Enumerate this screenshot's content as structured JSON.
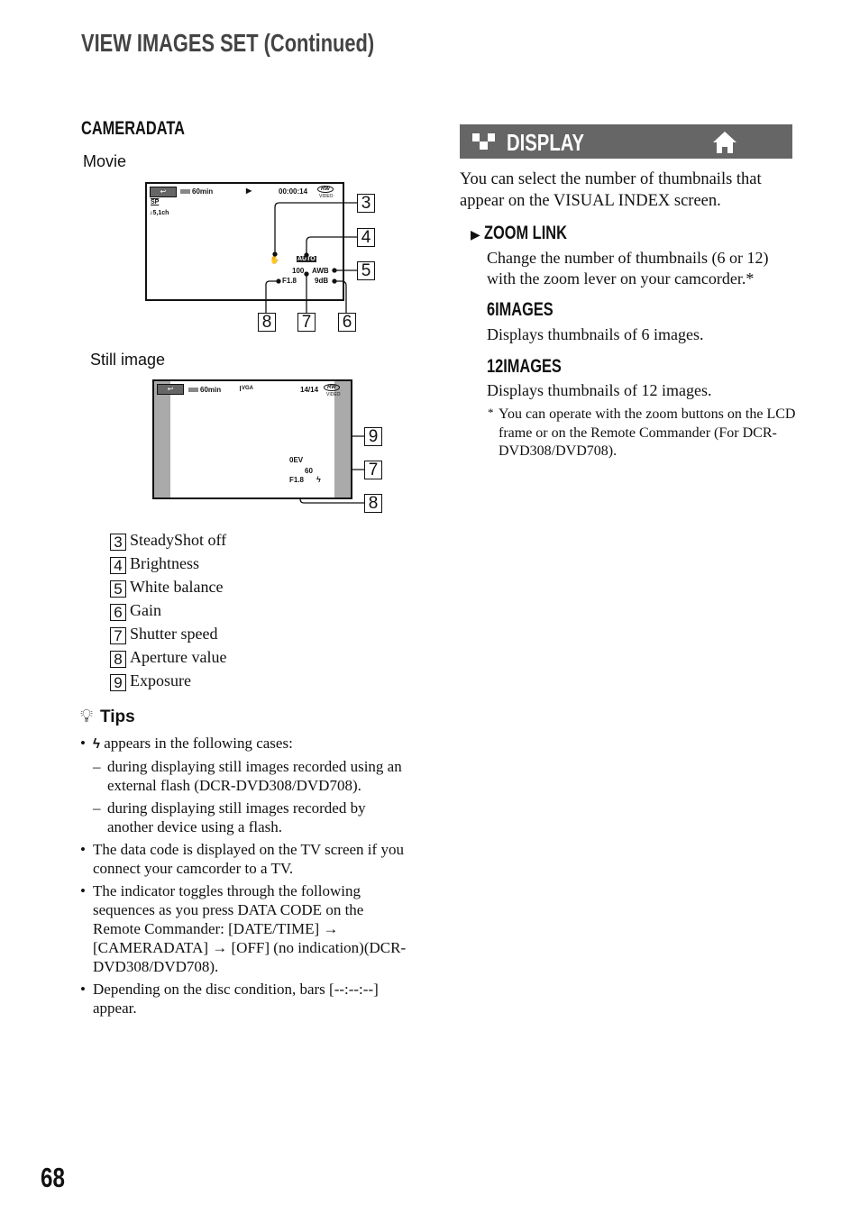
{
  "header": {
    "title": "VIEW IMAGES SET (Continued)"
  },
  "left": {
    "section_heading": "CAMERADATA",
    "movie": {
      "label": "Movie",
      "battery": "60min",
      "play_icon": "play-icon",
      "timecode": "00:00:14",
      "disc": "RW",
      "disc_sub": "VIDEO",
      "quality": "SP",
      "audio": "5,1ch",
      "brightness": "AUTO",
      "shutter": "100",
      "white_balance": "AWB",
      "aperture": "F1.8",
      "gain": "9dB",
      "steadyshot_icon": "steadyshot-off-icon"
    },
    "still": {
      "label": "Still image",
      "battery": "60min",
      "size": "VGA",
      "counter": "14/14",
      "disc": "RW",
      "disc_sub": "VIDEO",
      "exposure": "0EV",
      "shutter": "60",
      "aperture": "F1.8",
      "flash_icon": "flash-icon"
    },
    "callouts": {
      "n3": "3",
      "n4": "4",
      "n5": "5",
      "n6": "6",
      "n7": "7",
      "n8": "8",
      "n9": "9"
    },
    "legend": [
      {
        "num": "3",
        "label": "SteadyShot off"
      },
      {
        "num": "4",
        "label": "Brightness"
      },
      {
        "num": "5",
        "label": "White balance"
      },
      {
        "num": "6",
        "label": "Gain"
      },
      {
        "num": "7",
        "label": "Shutter speed"
      },
      {
        "num": "8",
        "label": "Aperture value"
      },
      {
        "num": "9",
        "label": "Exposure"
      }
    ],
    "tips": {
      "heading": "Tips",
      "item1": "appears in the following cases:",
      "sub1": "during displaying still images recorded using an external flash (DCR-DVD308/DVD708).",
      "sub2": "during displaying still images recorded by another device using a flash.",
      "item2": "The data code is displayed on the TV screen if you connect your camcorder to a TV.",
      "item3": "The indicator toggles through the following sequences as you press DATA CODE on the Remote Commander: [DATE/TIME] → [CAMERADATA] → [OFF] (no indication)(DCR-DVD308/DVD708).",
      "item4": "Depending on the disc condition, bars [--:--:--] appear."
    }
  },
  "right": {
    "bar_title": "DISPLAY",
    "bar_color": "#666666",
    "intro": "You can select the number of thumbnails that appear on the VISUAL INDEX screen.",
    "options": [
      {
        "heading": "ZOOM LINK",
        "text": "Change the number of thumbnails (6 or 12) with the zoom lever on your camcorder.*"
      },
      {
        "heading": "6IMAGES",
        "text": "Displays thumbnails of 6 images."
      },
      {
        "heading": "12IMAGES",
        "text": "Displays thumbnails of 12 images."
      }
    ],
    "footnote_mark": "*",
    "footnote": "You can operate with the zoom buttons on the LCD frame or on the Remote Commander (For DCR-DVD308/DVD708)."
  },
  "page_number": "68"
}
